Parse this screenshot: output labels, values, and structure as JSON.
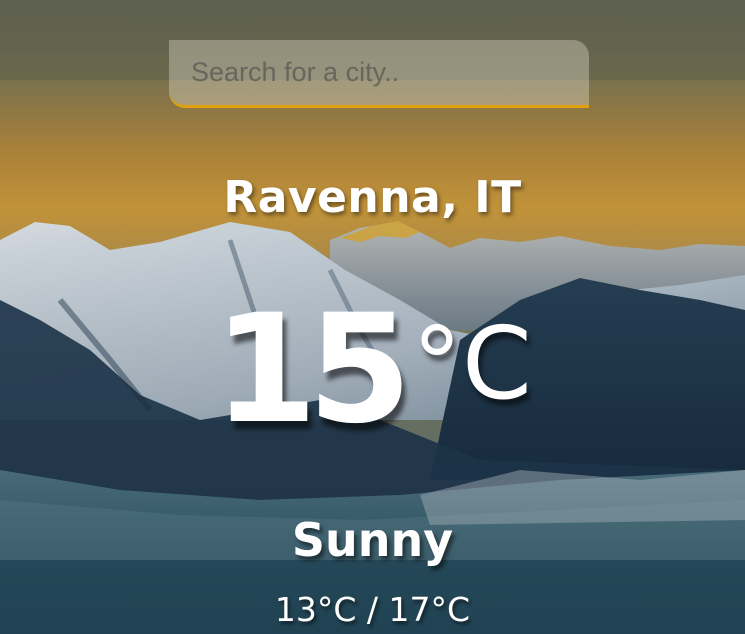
{
  "search": {
    "placeholder": "Search for a city..",
    "value": ""
  },
  "weather": {
    "location": "Ravenna, IT",
    "temperature": "15",
    "unit": "°C",
    "condition": "Sunny",
    "hi_lo": "13°C / 17°C"
  },
  "colors": {
    "accent": "#e0a00e",
    "sky_top": "#6b6a4e",
    "sky_glow": "#d4952e",
    "mountain_dark": "#1f3a52",
    "snow": "#e6edf2",
    "valley": "#3f6f80"
  }
}
